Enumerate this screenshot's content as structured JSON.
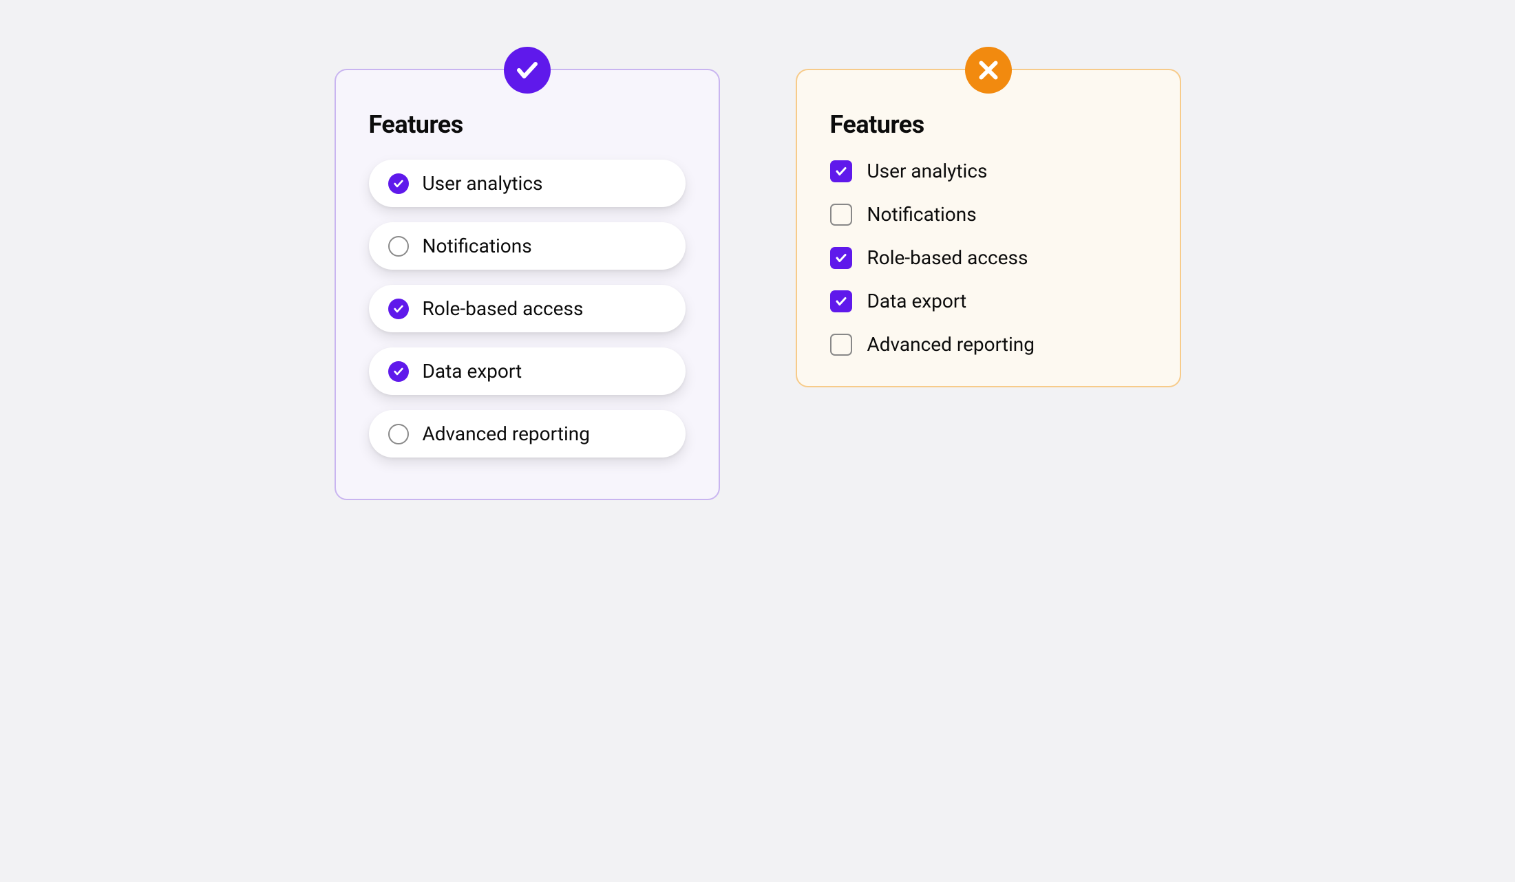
{
  "colors": {
    "accent_purple": "#5f19eb",
    "accent_orange": "#f28a0f",
    "panel_left_border": "#c9b5f0",
    "panel_right_border": "#f7cb8a"
  },
  "left_panel": {
    "badge": "check",
    "title": "Features",
    "items": [
      {
        "label": "User analytics",
        "checked": true
      },
      {
        "label": "Notifications",
        "checked": false
      },
      {
        "label": "Role-based access",
        "checked": true
      },
      {
        "label": "Data export",
        "checked": true
      },
      {
        "label": "Advanced reporting",
        "checked": false
      }
    ]
  },
  "right_panel": {
    "badge": "cross",
    "title": "Features",
    "items": [
      {
        "label": "User analytics",
        "checked": true
      },
      {
        "label": "Notifications",
        "checked": false
      },
      {
        "label": "Role-based access",
        "checked": true
      },
      {
        "label": "Data export",
        "checked": true
      },
      {
        "label": "Advanced reporting",
        "checked": false
      }
    ]
  }
}
